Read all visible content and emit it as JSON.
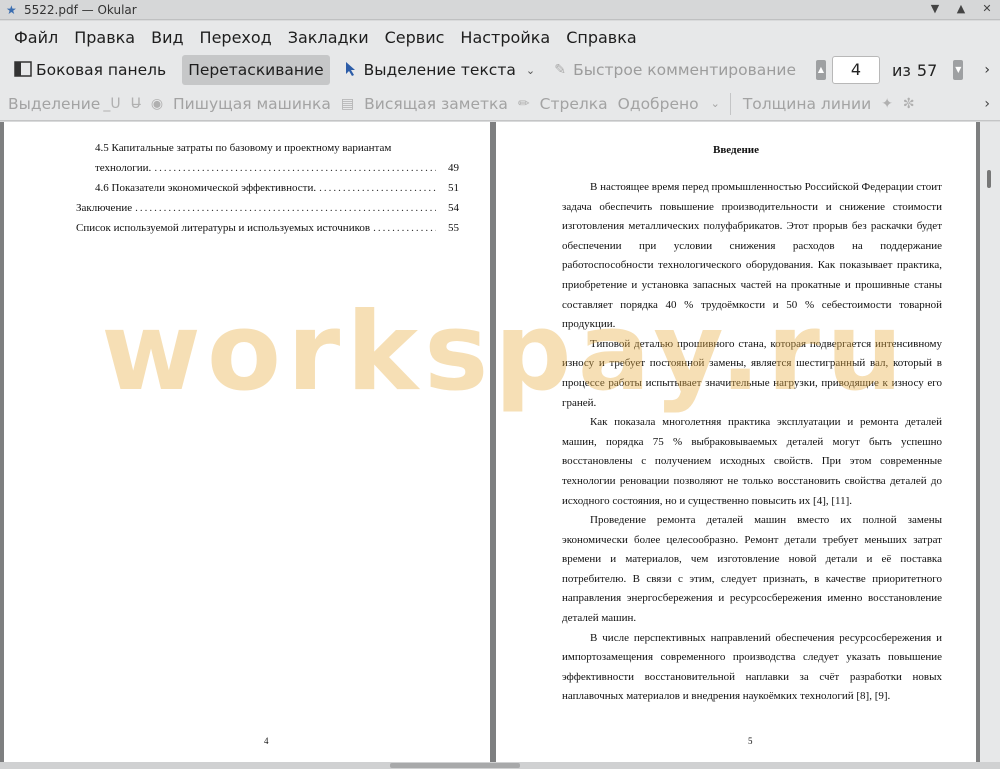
{
  "window": {
    "title": "5522.pdf — Okular"
  },
  "menu": [
    "Файл",
    "Правка",
    "Вид",
    "Переход",
    "Закладки",
    "Сервис",
    "Настройка",
    "Справка"
  ],
  "toolbar": {
    "sidebar_label": "Боковая панель",
    "drag_label": "Перетаскивание",
    "text_select_label": "Выделение текста",
    "quick_comment_label": "Быстрое комментирование",
    "page_current": "4",
    "page_of_label": "из",
    "page_total": "57"
  },
  "annotations_toolbar": {
    "highlight_label": "Выделение",
    "typewriter_label": "Пишущая машинка",
    "popup_note_label": "Висящая заметка",
    "arrow_label": "Стрелка",
    "stamp_label": "Одобрено",
    "line_width_label": "Толщина линии"
  },
  "left_page": {
    "toc": [
      {
        "text": "4.5 Капитальные затраты по базовому и проектному вариантам",
        "page": ""
      },
      {
        "text": "технологии.",
        "page": "49"
      },
      {
        "text": "4.6 Показатели экономической эффективности.",
        "page": "51"
      },
      {
        "text": "Заключение",
        "page": "54"
      },
      {
        "text": "Список используемой литературы и используемых источников",
        "page": "55"
      }
    ],
    "page_number": "4"
  },
  "right_page": {
    "heading": "Введение",
    "paragraphs": [
      "В настоящее время перед промышленностью Российской Федерации стоит задача обеспечить повышение производительности и снижение стоимости изготовления металлических полуфабрикатов. Этот прорыв без раскачки будет обеспечении при условии снижения расходов на поддержание работоспособности технологического оборудования. Как показывает практика, приобретение и установка запасных частей на прокатные и прошивные станы составляет порядка 40 % трудоёмкости и 50 % себестоимости товарной продукции.",
      "Типовой деталью прошивного стана, которая подвергается интенсивному износу и требует постоянной замены, является шестигранный вал, который в процессе работы испытывает значительные нагрузки, приводящие к износу его граней.",
      "Как показала многолетняя практика эксплуатации и ремонта деталей машин, порядка 75 % выбраковываемых деталей могут быть успешно восстановлены с получением исходных свойств. При этом современные технологии реновации позволяют не только восстановить свойства деталей до исходного состояния, но и существенно повысить их [4], [11].",
      "Проведение ремонта деталей машин вместо их полной замены экономически более целесообразно. Ремонт детали требует меньших затрат времени и материалов, чем изготовление новой детали и её поставка потребителю. В связи с этим, следует признать, в качестве приоритетного направления энергосбережения и ресурсосбережения именно восстановление деталей машин.",
      "В числе перспективных направлений обеспечения ресурсосбережения и импортозамещения современного производства следует указать повышение эффективности восстановительной наплавки за счёт разработки новых наплавочных материалов и внедрения наукоёмких технологий [8], [9]."
    ],
    "page_number": "5"
  },
  "watermark": "workspay.ru"
}
